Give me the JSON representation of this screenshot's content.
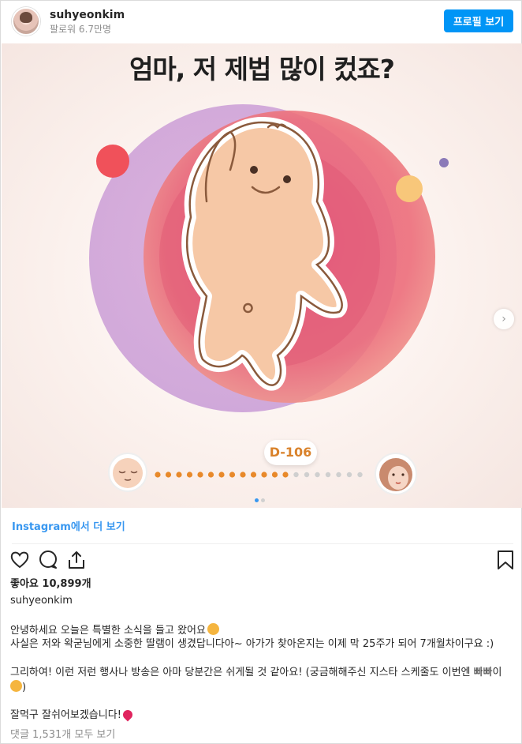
{
  "header": {
    "username": "suhyeonkim",
    "followers": "팔로워 6.7만명",
    "profile_button": "프로필 보기"
  },
  "post_image": {
    "headline": "엄마, 저 제법 많이 컸죠?",
    "dday_label": "D-106",
    "progress_dots_total": 20,
    "progress_dots_filled": 13,
    "carousel_total": 2,
    "carousel_current": 1
  },
  "links": {
    "instagram": "Instagram에서 더 보기"
  },
  "actions": {
    "like_icon": "heart-icon",
    "comment_icon": "comment-icon",
    "share_icon": "share-icon",
    "save_icon": "bookmark-icon"
  },
  "likes": "좋아요 10,899개",
  "caption": {
    "username": "suhyeonkim",
    "line1": "안녕하세요 오늘은 특별한 소식을 들고 왔어요",
    "line2": "사실은 저와 왁굳님에게 소중한 딸램이 생겼답니다아~ 아가가 찾아온지는 이제 막 25주가 되어 7개월차이구요 :)",
    "line3": "그리하여! 이런 저런 행사나 방송은 아마 당분간은 쉬게될 것 같아요! (궁금해해주신 지스타 스케줄도 이번엔 빠빠이",
    "line3b": ")",
    "line4": "잘먹구 잘쉬어보겠습니다!"
  },
  "comments_link": "댓글 1,531개 모두 보기",
  "colors": {
    "accent_blue": "#0095f6",
    "link_blue": "#3897f0",
    "dday_orange": "#d9822b",
    "dot_filled": "#e8892a",
    "dot_empty": "#cfcfcf"
  }
}
